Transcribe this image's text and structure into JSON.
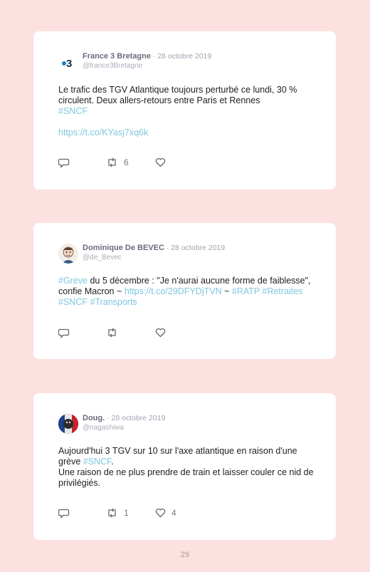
{
  "tweets": [
    {
      "name": "France 3 Bretagne",
      "sep": " · ",
      "date": "28 octobre 2019",
      "handle": "@france3Bretagne",
      "avatar_icon": "france3-logo-icon",
      "text_line1": "Le trafic des TGV Atlantique toujours perturbé ce lundi, 30 % circulent. Deux allers-retours entre Paris et Rennes",
      "hashtag": "#SNCF",
      "link": "https://t.co/KYasj7xq6k",
      "retweets": "6",
      "likes": ""
    },
    {
      "name": "Dominique De BEVEC",
      "sep": " · ",
      "date": "28 octobre 2019",
      "handle": "@de_Bevec",
      "avatar_icon": "cartoon-avatar-icon",
      "hashtag_start": "#Grève",
      "text_mid": " du 5 décembre : \"Je n'aurai aucune forme de faiblesse\", confie Macron ~ ",
      "link": "https://t.co/29DFYDjTVN",
      "text_after_link": " ~",
      "hashtags_end": "#RATP #Retraites #SNCF #Transports",
      "retweets": "",
      "likes": ""
    },
    {
      "name": "Doug.",
      "sep": " · ",
      "date": "28 octobre 2019",
      "handle": "@nagashiwa",
      "avatar_icon": "flag-avatar-icon",
      "text_line1": "Aujourd'hui 3 TGV sur 10 sur l'axe atlantique en raison d'une grève ",
      "hashtag": "#SNCF",
      "text_after_hashtag": ".",
      "text_line2": "Une raison de ne plus prendre de train et laisser couler ce nid de privilégiés.",
      "retweets": "1",
      "likes": "4"
    }
  ],
  "page_number": "29",
  "colors": {
    "background": "#fde0e0",
    "link": "#7ec6df",
    "name": "#6b6b7e"
  }
}
